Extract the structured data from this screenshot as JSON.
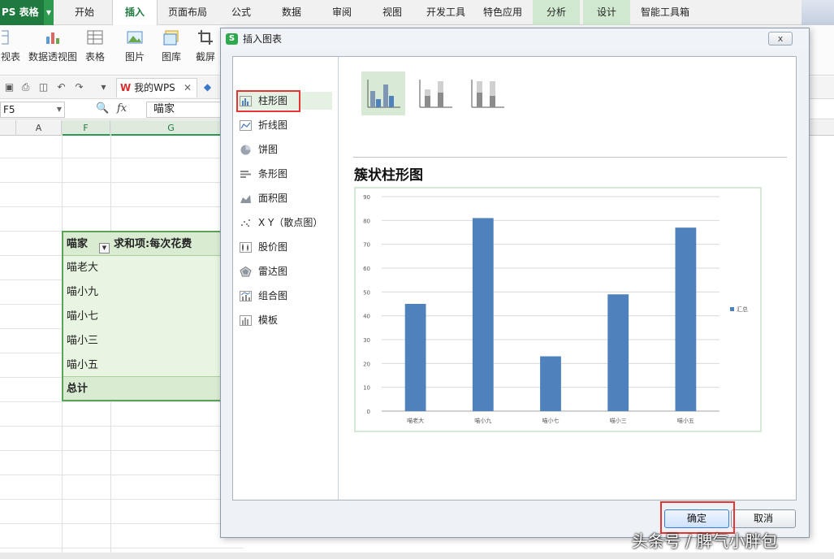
{
  "app": {
    "logo": "PS 表格"
  },
  "tabs": [
    {
      "label": "开始"
    },
    {
      "label": "插入"
    },
    {
      "label": "页面布局"
    },
    {
      "label": "公式"
    },
    {
      "label": "数据"
    },
    {
      "label": "审阅"
    },
    {
      "label": "视图"
    },
    {
      "label": "开发工具"
    },
    {
      "label": "特色应用"
    },
    {
      "label": "分析"
    },
    {
      "label": "设计"
    },
    {
      "label": "智能工具箱"
    }
  ],
  "ribbon": {
    "view": "视表",
    "pivot_table": "数据透视图",
    "table": "表格",
    "picture": "图片",
    "gallery": "图库",
    "screenshot": "截屏"
  },
  "doc_tab": {
    "brand": "W",
    "label": "我的WPS"
  },
  "formula_bar": {
    "cell_ref": "F5",
    "fx": "fx",
    "value": "喵家"
  },
  "columns": [
    "A",
    "F",
    "G"
  ],
  "pivot": {
    "header_row": "喵家",
    "header_value": "求和项:每次花费",
    "rows": [
      "喵老大",
      "喵小九",
      "喵小七",
      "喵小三",
      "喵小五"
    ],
    "total": "总计"
  },
  "dialog": {
    "title": "插入图表",
    "close": "x",
    "categories": [
      {
        "label": "柱形图",
        "icon": "column-chart-icon"
      },
      {
        "label": "折线图",
        "icon": "line-chart-icon"
      },
      {
        "label": "饼图",
        "icon": "pie-chart-icon"
      },
      {
        "label": "条形图",
        "icon": "bar-chart-icon"
      },
      {
        "label": "面积图",
        "icon": "area-chart-icon"
      },
      {
        "label": "X Y（散点图）",
        "icon": "scatter-chart-icon"
      },
      {
        "label": "股价图",
        "icon": "stock-chart-icon"
      },
      {
        "label": "雷达图",
        "icon": "radar-chart-icon"
      },
      {
        "label": "组合图",
        "icon": "combo-chart-icon"
      },
      {
        "label": "模板",
        "icon": "template-icon"
      }
    ],
    "selected_category": "柱形图",
    "preview_title": "簇状柱形图",
    "ok": "确定",
    "cancel": "取消"
  },
  "chart_data": {
    "type": "bar",
    "categories": [
      "喵老大",
      "喵小九",
      "喵小七",
      "喵小三",
      "喵小五"
    ],
    "series": [
      {
        "name": "汇总",
        "values": [
          45,
          81,
          23,
          49,
          77
        ]
      }
    ],
    "ylim": [
      0,
      90
    ],
    "yticks": [
      0,
      10,
      20,
      30,
      40,
      50,
      60,
      70,
      80,
      90
    ],
    "grid": true,
    "legend": "right",
    "colors": {
      "bar": "#4f81bd",
      "grid": "#d9d9d9"
    }
  },
  "watermark": "头条号 / 脾气小胖包"
}
